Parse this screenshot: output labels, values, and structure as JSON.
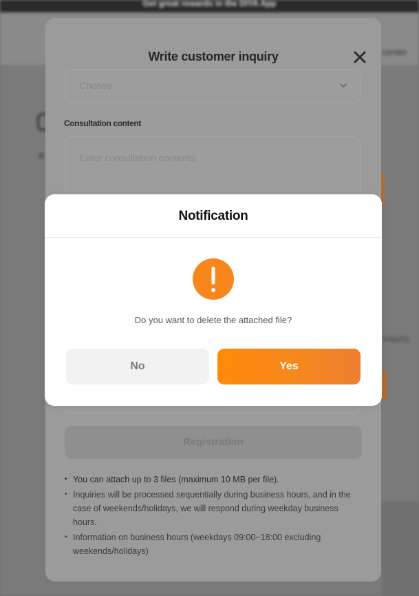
{
  "background": {
    "top_banner": "Get great rewards in the DIYA App",
    "header_link": "center",
    "right_text": "Inquiry"
  },
  "inquiry_modal": {
    "title": "Write customer inquiry",
    "category_select": {
      "placeholder": "Choose"
    },
    "content_label": "Consultation content",
    "content_placeholder": "Enter consultation contents",
    "register_label": "Registration",
    "notes": [
      "You can attach up to 3 files (maximum 10 MB per file).",
      "Inquiries will be processed sequentially during business hours, and in the case of weekends/holidays, we will respond during weekday business hours.",
      "Information on business hours (weekdays 09:00~18:00 excluding weekends/holidays)"
    ]
  },
  "notification": {
    "title": "Notification",
    "message": "Do you want to delete the attached file?",
    "no_label": "No",
    "yes_label": "Yes"
  },
  "icons": {
    "close": "close-icon",
    "chevron": "chevron-down-icon",
    "alert": "exclamation-icon"
  },
  "colors": {
    "accent": "#F7871C",
    "overlay_bg": "#6F6F6F",
    "dialog_bg": "#FFFFFF"
  }
}
